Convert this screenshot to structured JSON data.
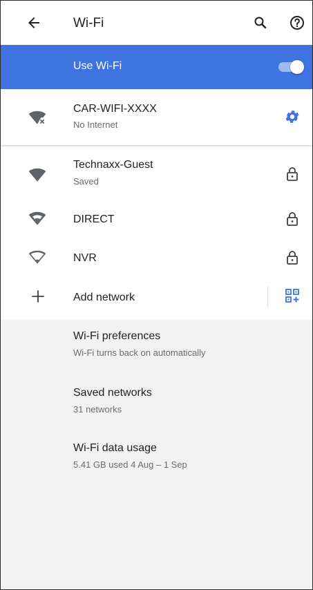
{
  "app_bar": {
    "title": "Wi-Fi",
    "back_icon": "arrow-back-icon",
    "search_icon": "search-icon",
    "help_icon": "help-icon"
  },
  "master_switch": {
    "label": "Use Wi-Fi",
    "state": "on",
    "color": "#3f73e0"
  },
  "connected_network": {
    "name": "CAR-WIFI-XXXX",
    "status": "No Internet",
    "icon": "wifi-no-internet-icon",
    "action_icon": "settings-gear-icon",
    "accent": "#3f73e0"
  },
  "networks": [
    {
      "name": "Technaxx-Guest",
      "status": "Saved",
      "icon": "wifi-full-icon",
      "lock": true
    },
    {
      "name": "DIRECT",
      "status": "",
      "icon": "wifi-outline-icon",
      "lock": true
    },
    {
      "name": "NVR",
      "status": "",
      "icon": "wifi-outline-icon",
      "lock": true
    }
  ],
  "add_network": {
    "label": "Add network",
    "icon": "plus-icon",
    "qr_icon": "qr-code-scanner-icon"
  },
  "preferences": [
    {
      "title": "Wi-Fi preferences",
      "summary": "Wi-Fi turns back on automatically"
    },
    {
      "title": "Saved networks",
      "summary": "31 networks"
    },
    {
      "title": "Wi-Fi data usage",
      "summary": "5.41 GB used 4 Aug – 1 Sep"
    }
  ]
}
